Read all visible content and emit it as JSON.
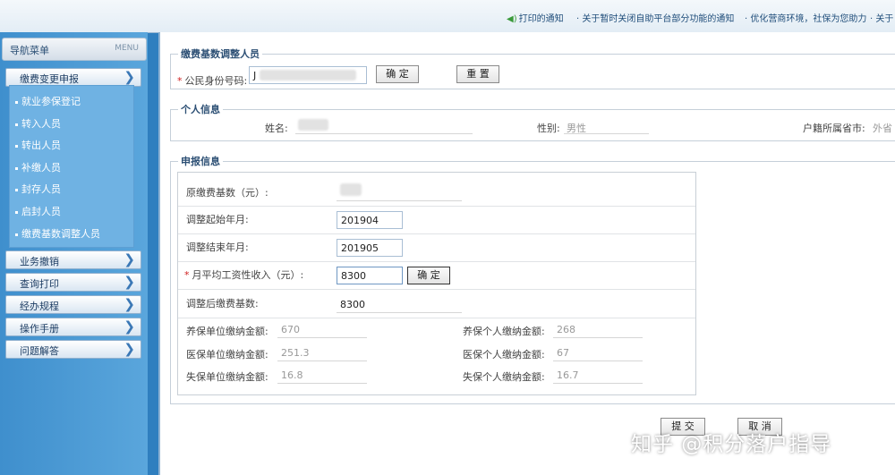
{
  "notices": [
    "打印的通知",
    "· 关于暂时关闭自助平台部分功能的通知",
    "· 优化营商环境，社保为您助力",
    "· 关于"
  ],
  "sidebar": {
    "title": "导航菜单",
    "title_en": "MENU",
    "categories": [
      "缴费变更申报",
      "业务撤销",
      "查询打印",
      "经办规程",
      "操作手册",
      "问题解答"
    ],
    "sub_items": [
      "就业参保登记",
      "转入人员",
      "转出人员",
      "补缴人员",
      "封存人员",
      "启封人员",
      "缴费基数调整人员"
    ]
  },
  "form": {
    "legend": "缴费基数调整人员",
    "id_label": "公民身份号码:",
    "id_value": "J",
    "confirm": "确 定",
    "reset": "重 置"
  },
  "personal": {
    "legend": "个人信息",
    "name_label": "姓名:",
    "gender_label": "性别:",
    "gender_value": "男性",
    "hukou_label": "户籍所属省市:",
    "hukou_value": "外省"
  },
  "declare": {
    "legend": "申报信息",
    "orig_base_label": "原缴费基数（元）:",
    "start_label": "调整起始年月:",
    "start_value": "201904",
    "end_label": "调整结束年月:",
    "end_value": "201905",
    "income_label": "月平均工资性收入（元）:",
    "income_value": "8300",
    "income_confirm": "确 定",
    "new_base_label": "调整后缴费基数:",
    "new_base_value": "8300",
    "pension_unit_label": "养保单位缴纳金额:",
    "pension_unit_value": "670",
    "pension_person_label": "养保个人缴纳金额:",
    "pension_person_value": "268",
    "medical_unit_label": "医保单位缴纳金额:",
    "medical_unit_value": "251.3",
    "medical_person_label": "医保个人缴纳金额:",
    "medical_person_value": "67",
    "unemp_unit_label": "失保单位缴纳金额:",
    "unemp_unit_value": "16.8",
    "unemp_person_label": "失保个人缴纳金额:",
    "unemp_person_value": "16.7"
  },
  "actions": {
    "submit": "提 交",
    "cancel": "取 消"
  },
  "watermark": "知乎 @积分落户指导"
}
